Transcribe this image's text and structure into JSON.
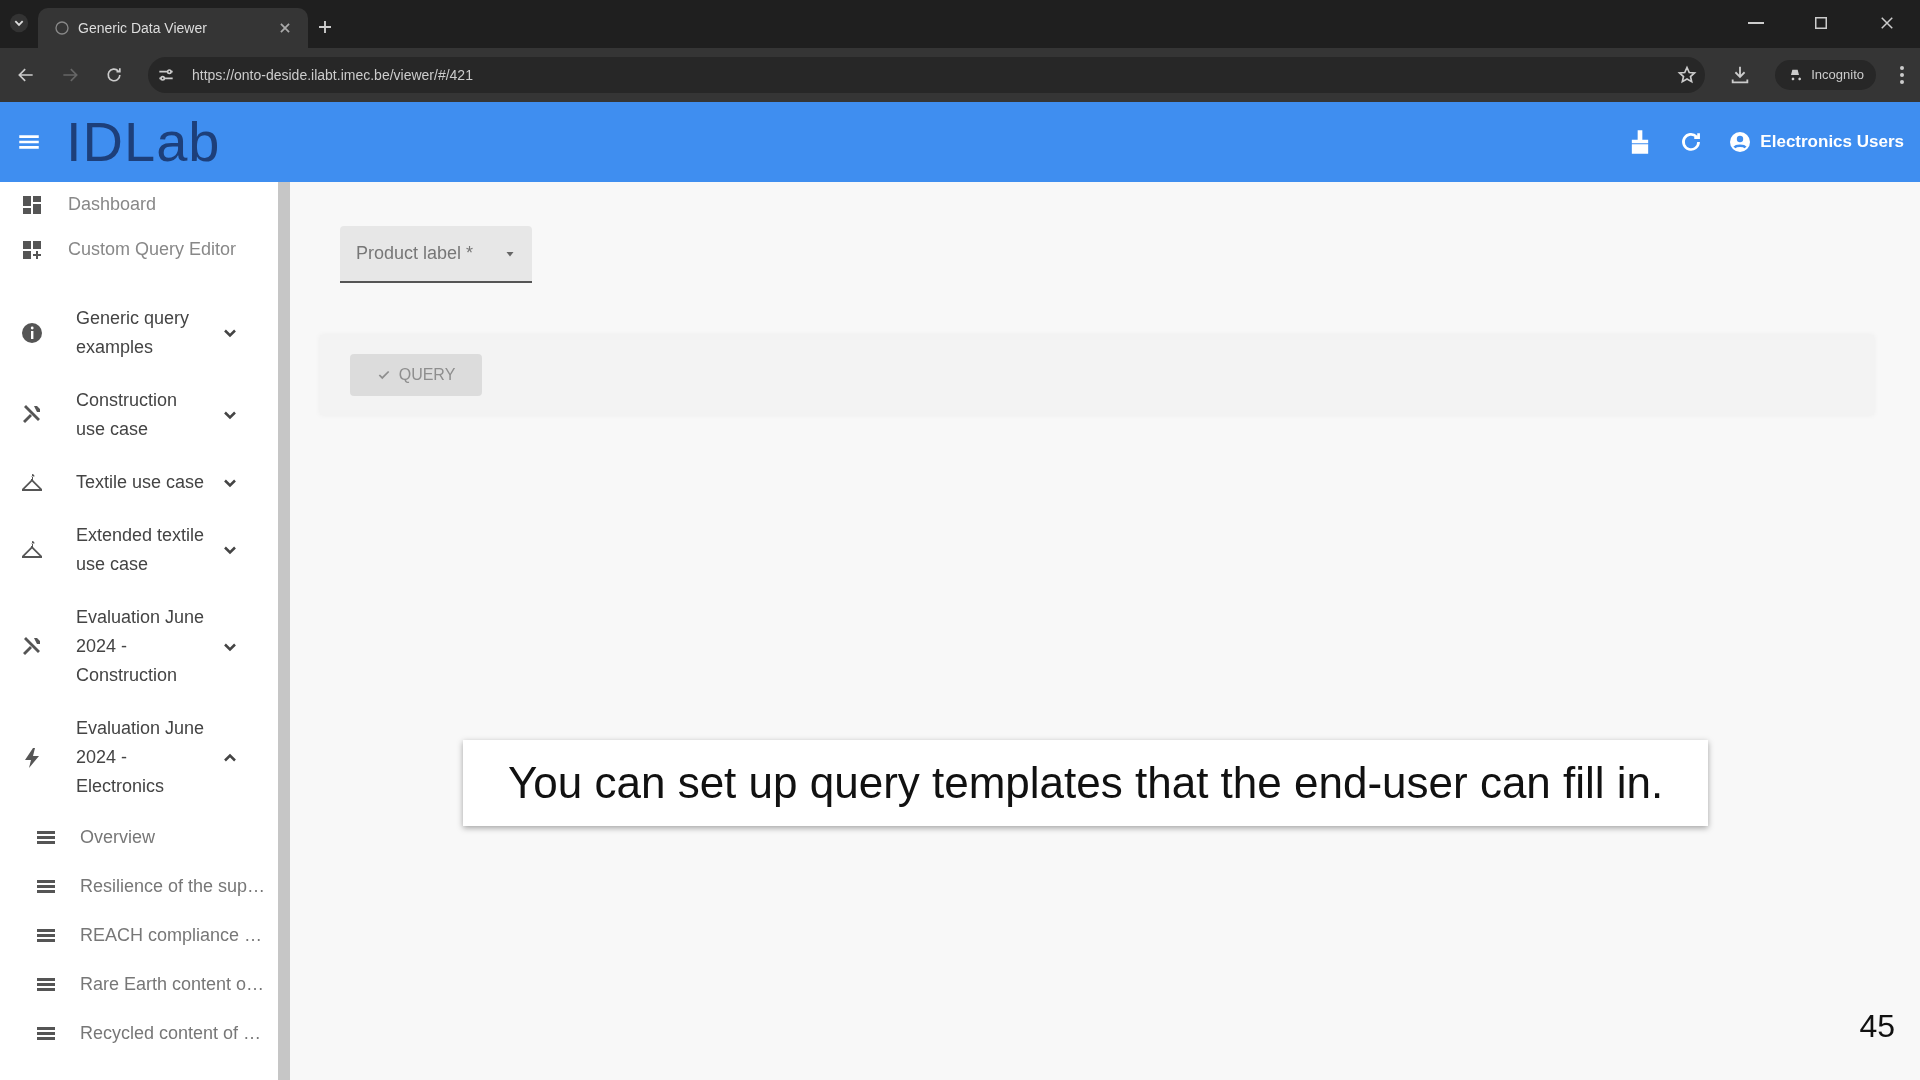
{
  "browser": {
    "tab_title": "Generic Data Viewer",
    "url": "https://onto-deside.ilabt.imec.be/viewer/#/421",
    "profile": "Incognito"
  },
  "header": {
    "logo": "IDLab",
    "user": "Electronics Users"
  },
  "sidebar": {
    "items": [
      {
        "kind": "link",
        "label": "Dashboard"
      },
      {
        "kind": "link",
        "label": "Custom Query Editor"
      },
      {
        "kind": "group",
        "label": "Generic query examples",
        "expanded": false
      },
      {
        "kind": "group",
        "label": "Construction use case",
        "expanded": false
      },
      {
        "kind": "group",
        "label": "Textile use case",
        "expanded": false
      },
      {
        "kind": "group",
        "label": "Extended textile use case",
        "expanded": false
      },
      {
        "kind": "group",
        "label": "Evaluation June 2024 - Construction",
        "expanded": false
      },
      {
        "kind": "group",
        "label": "Evaluation June 2024 - Electronics",
        "expanded": true,
        "children": [
          {
            "label": "Overview"
          },
          {
            "label": "Resilience of the sup…"
          },
          {
            "label": "REACH compliance …"
          },
          {
            "label": "Rare Earth content o…"
          },
          {
            "label": "Recycled content of …"
          }
        ]
      }
    ]
  },
  "form": {
    "select": {
      "label": "Product label *"
    },
    "query_button": {
      "label": "QUERY",
      "disabled": true
    }
  },
  "caption": "You can set up query templates that the end-user can fill in.",
  "slide_number": "45"
}
